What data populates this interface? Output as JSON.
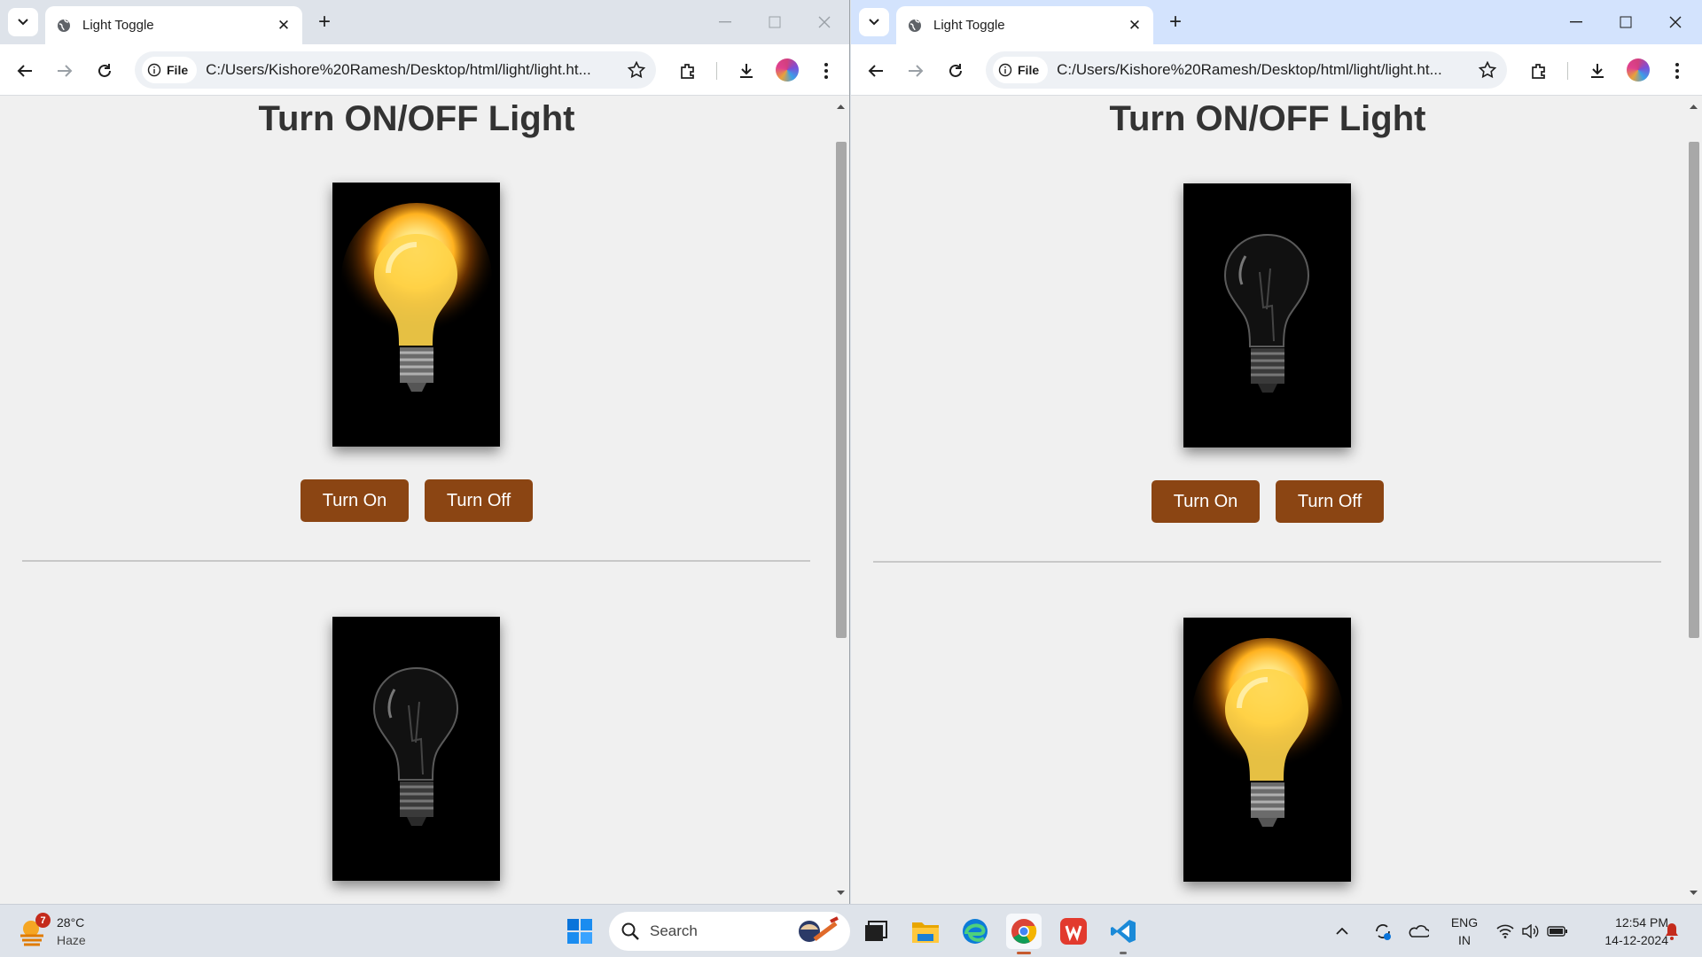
{
  "windows": [
    {
      "id": "left",
      "tab_title": "Light Toggle",
      "url_chip": "File",
      "url": "C:/Users/Kishore%20Ramesh/Desktop/html/light/light.ht...",
      "page": {
        "heading": "Turn ON/OFF Light",
        "bulb1_state": "on",
        "bulb2_state": "off",
        "on_label": "Turn On",
        "off_label": "Turn Off"
      }
    },
    {
      "id": "right",
      "tab_title": "Light Toggle",
      "url_chip": "File",
      "url": "C:/Users/Kishore%20Ramesh/Desktop/html/light/light.ht...",
      "page": {
        "heading": "Turn ON/OFF Light",
        "bulb1_state": "off",
        "bulb2_state": "on",
        "on_label": "Turn On",
        "off_label": "Turn Off"
      }
    }
  ],
  "taskbar": {
    "weather": {
      "temp": "28°C",
      "condition": "Haze",
      "badge": "7"
    },
    "search_placeholder": "Search",
    "apps": [
      "start-icon",
      "search",
      "task-view-icon",
      "file-explorer-icon",
      "edge-icon",
      "chrome-icon",
      "wps-office-icon",
      "vscode-icon"
    ],
    "tray": {
      "lang1": "ENG",
      "lang2": "IN",
      "time": "12:54 PM",
      "date": "14-12-2024"
    }
  },
  "colors": {
    "button_bg": "#8b4513",
    "page_bg": "#f0f0f0",
    "heading": "#333333"
  }
}
